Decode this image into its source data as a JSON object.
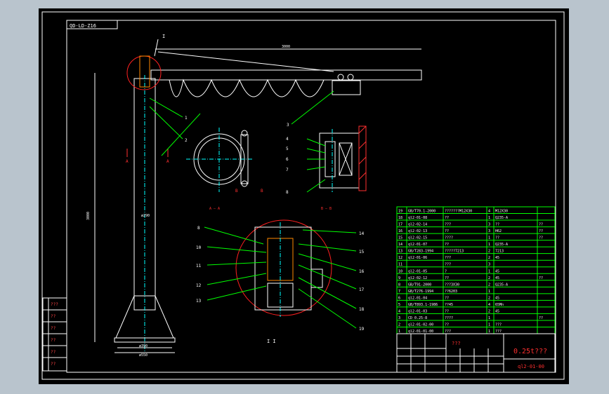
{
  "drawing": {
    "code_box": "QD-LD-Z16",
    "title": "0.25t???",
    "drawing_number": "ql2-01-00",
    "name_cell": "???",
    "section_i_marker": "I",
    "section_i_label": "I I",
    "section_a_label": "A — A",
    "section_b_label": "B — B"
  },
  "dimensions": {
    "arm_length": "3000",
    "column_height": "3000",
    "base_top": "ø290",
    "base_mid": "ø390",
    "base_bottom": "ø550"
  },
  "callouts": {
    "main_left": [
      "1",
      "2",
      "3"
    ],
    "main_right": [
      "3",
      "4"
    ],
    "bb_left": [
      "4",
      "5",
      "6",
      "7",
      "8"
    ],
    "detail_left": [
      "8",
      "10",
      "11",
      "12",
      "13"
    ],
    "detail_right": [
      "14",
      "15",
      "16",
      "17",
      "18",
      "19"
    ]
  },
  "section_marks": {
    "a": [
      "A",
      "A"
    ],
    "b": [
      "B",
      "B"
    ]
  },
  "bom": {
    "rows": [
      [
        "19",
        "GB/T70.1-2000",
        "???????M12X30",
        "4",
        "M12X30",
        ""
      ],
      [
        "18",
        "ql2-01-08",
        "??",
        "1",
        "Q235-A",
        ""
      ],
      [
        "17",
        "ql2-02-14",
        "???",
        "3",
        "??",
        "??"
      ],
      [
        "16",
        "ql2-02-13",
        "??",
        "3",
        "H62",
        "??"
      ],
      [
        "15",
        "ql2-02-15",
        "????",
        "1",
        "??",
        "??"
      ],
      [
        "14",
        "ql2-01-07",
        "??",
        "1",
        "Q235-A",
        ""
      ],
      [
        "13",
        "GB/T283-1994",
        "?????7213",
        "2",
        "7213",
        ""
      ],
      [
        "12",
        "ql2-01-06",
        "???",
        "2",
        "45",
        ""
      ],
      [
        "11",
        "",
        "???",
        "3",
        "",
        ""
      ],
      [
        "10",
        "ql2-01-05",
        "?",
        "1",
        "45",
        ""
      ],
      [
        "9",
        "ql2-02-12",
        "??",
        "2",
        "45",
        "??"
      ],
      [
        "8",
        "GB/T91-2000",
        "???3X30",
        "2",
        "Q235-A",
        ""
      ],
      [
        "7",
        "GB/T276-1994",
        "??6203",
        "1",
        "",
        ""
      ],
      [
        "6",
        "ql2-01-04",
        "??",
        "2",
        "45",
        ""
      ],
      [
        "5",
        "GB/T893.1-1986",
        "??45",
        "4",
        "65Mn",
        ""
      ],
      [
        "4",
        "ql2-01-03",
        "??",
        "2",
        "45",
        ""
      ],
      [
        "3",
        "CD 0.25-8",
        "????",
        "1",
        "",
        "??"
      ],
      [
        "2",
        "ql2-01-02-00",
        "??",
        "1",
        "???",
        ""
      ],
      [
        "1",
        "ql2-01-01-00",
        "???",
        "1",
        "???",
        ""
      ]
    ]
  },
  "revision_labels": [
    "???",
    "??",
    "??",
    "??",
    "??",
    "??"
  ],
  "colors": {
    "line": "#ffffff",
    "border": "#ffffff",
    "callout": "#00ff00",
    "center": "#00ffff",
    "detail_circle": "#ff2020",
    "red": "#ff3030",
    "hatch": "#ff3030",
    "bom": "#00ff00",
    "yellow": "#ffff00"
  }
}
